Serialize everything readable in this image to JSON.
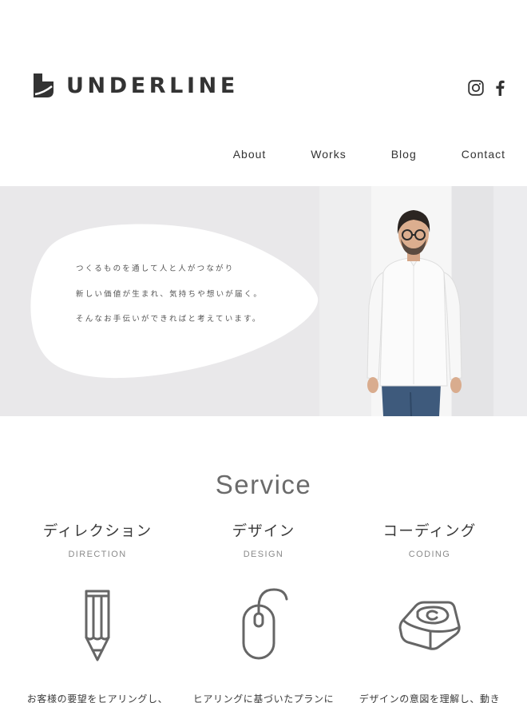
{
  "header": {
    "logo_text": "UNDERLINE",
    "social": [
      {
        "name": "instagram-icon"
      },
      {
        "name": "facebook-icon",
        "glyph": "f"
      }
    ]
  },
  "nav": {
    "items": [
      "About",
      "Works",
      "Blog",
      "Contact"
    ]
  },
  "hero": {
    "lines": [
      "つくるものを通して人と人がつながり",
      "新しい価値が生まれ、気持ちや想いが届く。",
      "そんなお手伝いができればと考えています。"
    ],
    "background": "#e9e8ea"
  },
  "service": {
    "title": "Service",
    "items": [
      {
        "title": "ディレクション",
        "subtitle": "DIRECTION",
        "icon": "pencil-icon",
        "description": "お客様の要望をヒアリングし、"
      },
      {
        "title": "デザイン",
        "subtitle": "DESIGN",
        "icon": "mouse-icon",
        "description": "ヒアリングに基づいたプランに"
      },
      {
        "title": "コーディング",
        "subtitle": "CODING",
        "icon": "keyboard-key-icon",
        "description": "デザインの意図を理解し、動き"
      }
    ]
  },
  "colors": {
    "text": "#3a3a3a",
    "muted": "#8a8a8a",
    "icon_stroke": "#666666"
  }
}
